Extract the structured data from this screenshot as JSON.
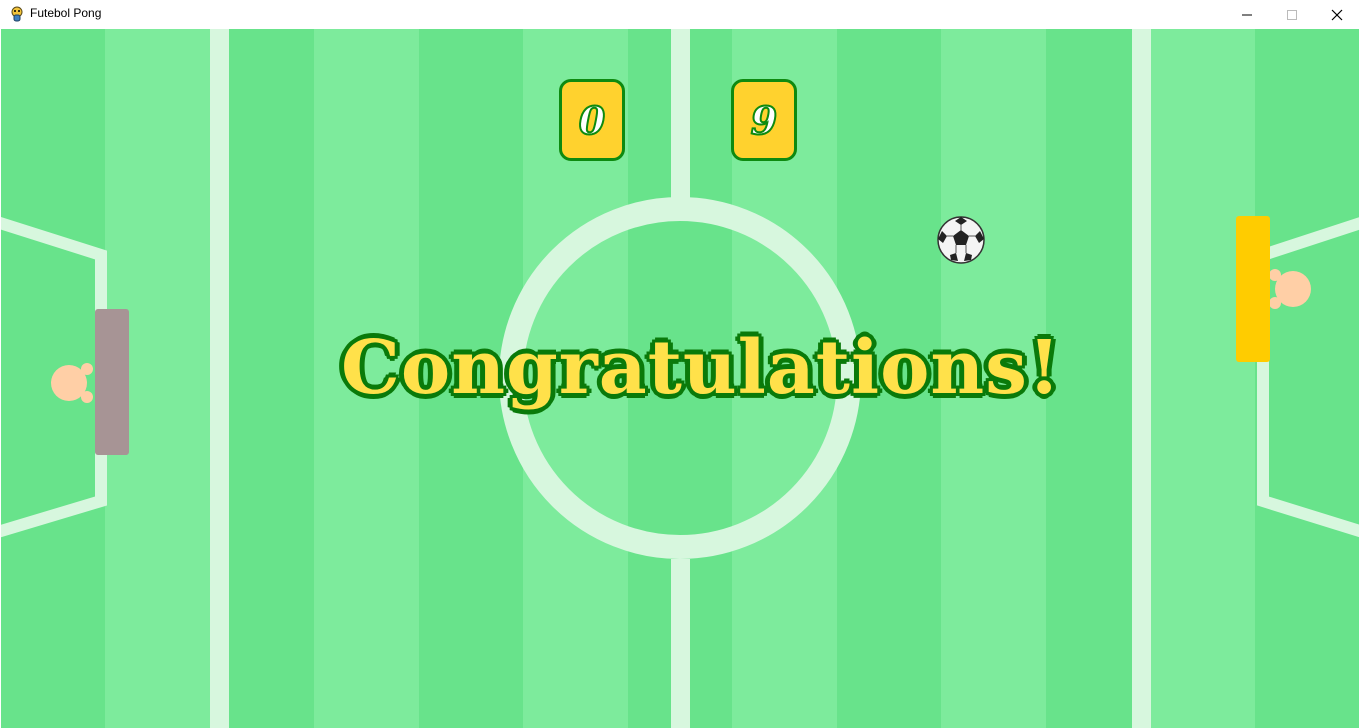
{
  "window": {
    "title": "Futebol Pong",
    "app_icon": "pygame-snake-icon",
    "controls": [
      "minimize-icon",
      "maximize-icon",
      "close-icon"
    ]
  },
  "game": {
    "scores": {
      "left": "0",
      "right": "9"
    },
    "message": "Congratulations!",
    "colors": {
      "field_light": "#7deb9c",
      "field_dark": "#68e38b",
      "lines": "#d7f7de",
      "score_fill": "#ffd22e",
      "score_border": "#0e8a10",
      "message_fill": "#ffe14a",
      "message_outline": "#0a7a0a",
      "left_paddle": "#a79495",
      "right_paddle": "#ffcc00",
      "hands": "#ffcfa6"
    }
  }
}
